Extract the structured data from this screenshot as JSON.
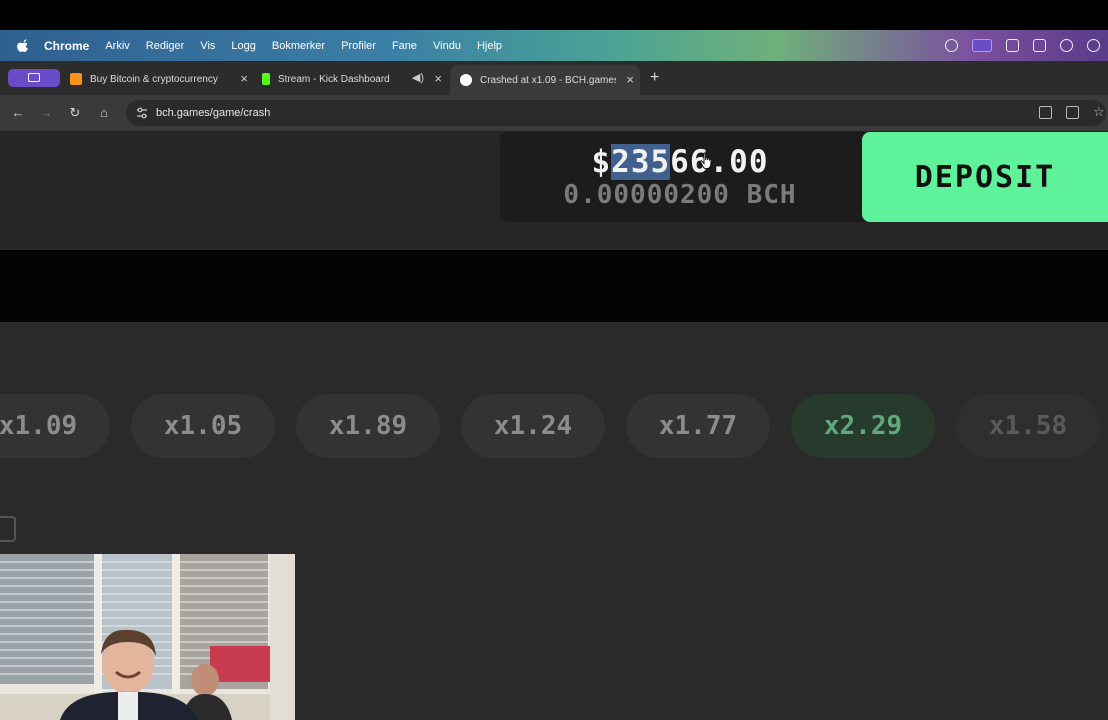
{
  "menubar": {
    "app": "Chrome",
    "items": [
      "Arkiv",
      "Rediger",
      "Vis",
      "Logg",
      "Bokmerker",
      "Profiler",
      "Fane",
      "Vindu",
      "Hjelp"
    ]
  },
  "tabs": [
    {
      "title": "Buy Bitcoin & cryptocurrency",
      "favicon_color": "#f7931a",
      "icon": "bitcoin-favicon-icon"
    },
    {
      "title": "Stream - Kick Dashboard",
      "favicon_color": "#53fc18",
      "icon": "kick-favicon-icon"
    },
    {
      "title": "Crashed at x1.09 - BCH.games",
      "favicon_color": "#ffffff",
      "icon": "bch-games-favicon-icon",
      "active": true
    }
  ],
  "address": {
    "url": "bch.games/game/crash"
  },
  "balance": {
    "usd_prefix": "$",
    "usd_selected": "235",
    "usd_rest": "66.00",
    "bch": "0.00000200 BCH"
  },
  "deposit_label": "DEPOSIT",
  "history": [
    {
      "label": "x1.09",
      "state": "normal"
    },
    {
      "label": "x1.05",
      "state": "normal"
    },
    {
      "label": "x1.89",
      "state": "normal"
    },
    {
      "label": "x1.24",
      "state": "normal"
    },
    {
      "label": "x1.77",
      "state": "normal"
    },
    {
      "label": "x2.29",
      "state": "green"
    },
    {
      "label": "x1.58",
      "state": "faded"
    }
  ],
  "colors": {
    "deposit": "#5ef29a",
    "green_chip": "#5fa97c",
    "selection": "#40618d"
  }
}
